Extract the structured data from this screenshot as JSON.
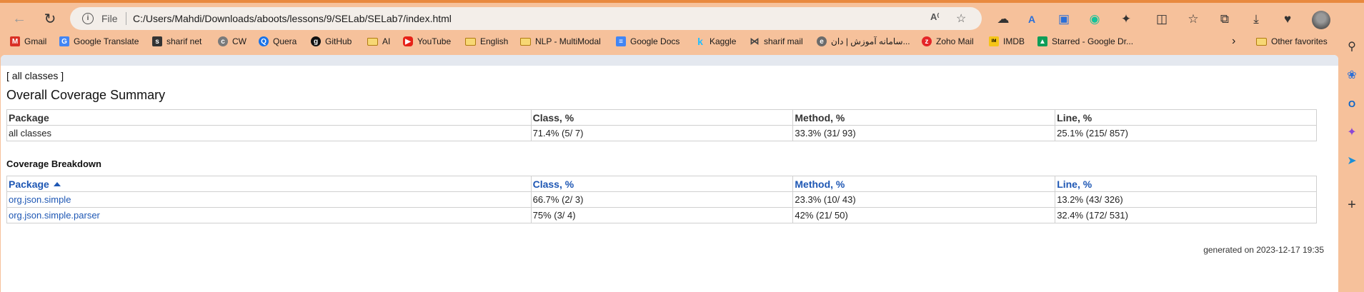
{
  "browser": {
    "address": {
      "scheme_label": "File",
      "url": "C:/Users/Mahdi/Downloads/aboots/lessons/9/SELab/SELab7/index.html"
    },
    "bookmarks": [
      {
        "label": "Gmail",
        "icon": "gmail-icon",
        "color": "#d93025"
      },
      {
        "label": "Google Translate",
        "icon": "translate-icon",
        "color": "#4285f4"
      },
      {
        "label": "sharif net",
        "icon": "sharif-icon",
        "color": "#333333"
      },
      {
        "label": "CW",
        "icon": "cw-icon",
        "color": "#7a7a7a"
      },
      {
        "label": "Quera",
        "icon": "quera-icon",
        "color": "#1a73e8"
      },
      {
        "label": "GitHub",
        "icon": "github-icon",
        "color": "#111111"
      },
      {
        "label": "AI",
        "icon": "folder-icon"
      },
      {
        "label": "YouTube",
        "icon": "youtube-icon",
        "color": "#e62117"
      },
      {
        "label": "English",
        "icon": "folder-icon"
      },
      {
        "label": "NLP - MultiModal",
        "icon": "folder-icon"
      },
      {
        "label": "Google Docs",
        "icon": "docs-icon",
        "color": "#4285f4"
      },
      {
        "label": "Kaggle",
        "icon": "kaggle-icon",
        "color": "#20beff"
      },
      {
        "label": "sharif mail",
        "icon": "mail-icon",
        "color": "#444444"
      },
      {
        "label": "سامانه آموزش | دان...",
        "icon": "edu-icon",
        "color": "#6b6b6b"
      },
      {
        "label": "Zoho Mail",
        "icon": "zoho-icon",
        "color": "#e42527"
      },
      {
        "label": "IMDB",
        "icon": "imdb-icon",
        "color": "#f5c518"
      },
      {
        "label": "Starred - Google Dr...",
        "icon": "drive-icon",
        "color": "#0f9d58"
      }
    ],
    "other_favorites": "Other favorites"
  },
  "report": {
    "all_classes_link": "[ all classes ]",
    "title": "Overall Coverage Summary",
    "summary": {
      "headers": [
        "Package",
        "Class, %",
        "Method, %",
        "Line, %"
      ],
      "row": [
        "all classes",
        "71.4% (5/ 7)",
        "33.3% (31/ 93)",
        "25.1% (215/ 857)"
      ]
    },
    "breakdown_title": "Coverage Breakdown",
    "breakdown": {
      "headers": [
        "Package",
        "Class, %",
        "Method, %",
        "Line, %"
      ],
      "rows": [
        [
          "org.json.simple",
          "66.7% (2/ 3)",
          "23.3% (10/ 43)",
          "13.2% (43/ 326)"
        ],
        [
          "org.json.simple.parser",
          "75% (3/ 4)",
          "42% (21/ 50)",
          "32.4% (172/ 531)"
        ]
      ]
    },
    "generated": "generated on 2023-12-17 19:35"
  },
  "colors": {
    "chrome": "#f6c19b",
    "accent_strip": "#e8893f",
    "link": "#1e57b4"
  }
}
